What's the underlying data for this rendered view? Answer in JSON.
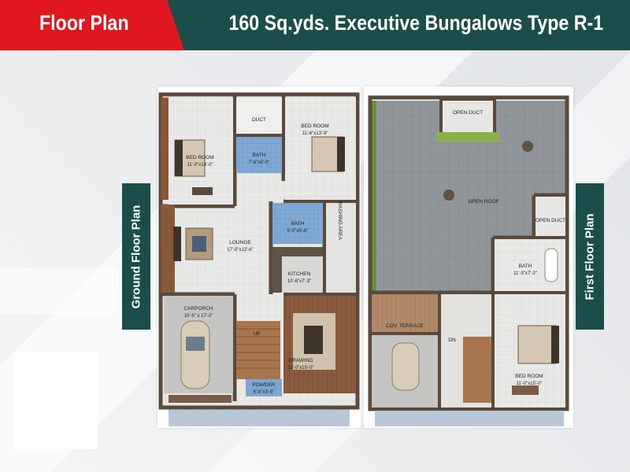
{
  "header": {
    "left_title": "Floor Plan",
    "right_title": "160 Sq.yds. Executive Bungalows Type R-1"
  },
  "side_labels": {
    "ground": "Ground Floor Plan",
    "first": "First Floor Plan"
  },
  "colors": {
    "header_teal": "#1b4d4a",
    "header_red": "#e1171f"
  },
  "ground_floor": {
    "duct": "DUCT",
    "bed_room_1": {
      "name": "BED ROOM",
      "size": "11'-0\"x14'-0\""
    },
    "bath_1": {
      "name": "BATH",
      "size": "7'-6\"x5'-0\""
    },
    "bed_room_2": {
      "name": "BED ROOM",
      "size": "11'-6\"x13'-9\""
    },
    "bath_2": {
      "name": "BATH",
      "size": "9'-0\"x5'-6\""
    },
    "washing_area": "WASHING AREA",
    "lounge": {
      "name": "LOUNGE",
      "size": "17'-0\"x12'-6\""
    },
    "kitchen": {
      "name": "KITCHEN",
      "size": "10'-6\"x7'-3\""
    },
    "carporch": {
      "name": "CARPORCH",
      "size": "10'-6\" x 17'-0\""
    },
    "up": "UP",
    "drawing": {
      "name": "DRAWING",
      "size": "11'-0\"x15'-0\""
    },
    "powder": {
      "name": "POWDER",
      "size": "8'-6\"x3'-6\""
    }
  },
  "first_floor": {
    "open_duct_top": "OPEN DUCT",
    "open_roof": "OPEN ROOF",
    "open_duct_side": "OPEN DUCT",
    "bath": {
      "name": "BATH",
      "size": "11'-3\"x7'-3\""
    },
    "cov_terrace": "COV. TERRACE",
    "dn": "DN",
    "bed_room": {
      "name": "BED ROOM",
      "size": "11'-0\"x15'-0\""
    }
  }
}
